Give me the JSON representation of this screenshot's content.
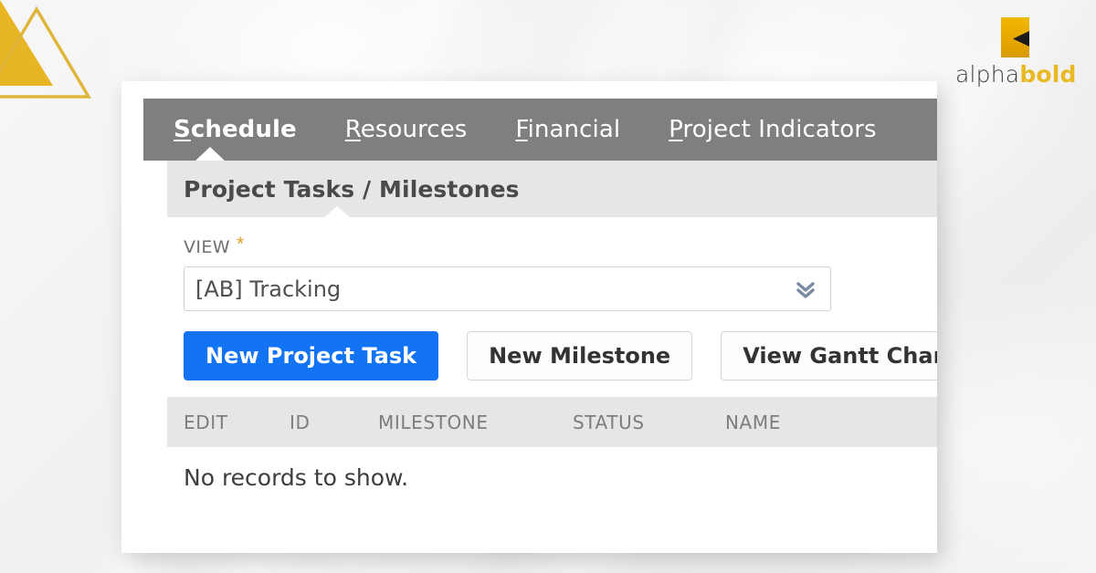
{
  "background": {
    "surface_color": "#f2f2f2",
    "accent_gold": "#e8b923"
  },
  "decor": {
    "triangle_filled_name": "gold-triangle-filled",
    "triangle_outline_name": "gold-triangle-outline"
  },
  "brand": {
    "mark_name": "alphabold-logo-mark",
    "word_alpha": "alpha",
    "word_bold": "bold",
    "mark_color": "#e8a800",
    "bold_color": "#e8b923",
    "alpha_color": "#3c3c3c"
  },
  "tabs": [
    {
      "label": "Schedule",
      "accesskey": "S",
      "rest": "chedule",
      "active": true
    },
    {
      "label": "Resources",
      "accesskey": "R",
      "rest": "esources",
      "active": false
    },
    {
      "label": "Financial",
      "accesskey": "F",
      "rest": "inancial",
      "active": false
    },
    {
      "label": "Project Indicators",
      "accesskey": "P",
      "rest": "roject Indicators",
      "active": false
    }
  ],
  "section": {
    "title": "Project Tasks / Milestones",
    "header_bg": "#e6e6e6",
    "tabbar_bg": "#7f7f7f"
  },
  "view_field": {
    "label": "VIEW",
    "required_marker": "*",
    "selected_value": "[AB] Tracking",
    "dropdown_icon": "double-chevron-down-icon"
  },
  "actions": {
    "new_project_task": "New Project Task",
    "new_milestone": "New Milestone",
    "view_gantt_chart": "View Gantt Chart",
    "primary_color": "#1273f3"
  },
  "table": {
    "columns": [
      "EDIT",
      "ID",
      "MILESTONE",
      "STATUS",
      "NAME"
    ],
    "empty_message": "No records to show.",
    "rows": []
  }
}
